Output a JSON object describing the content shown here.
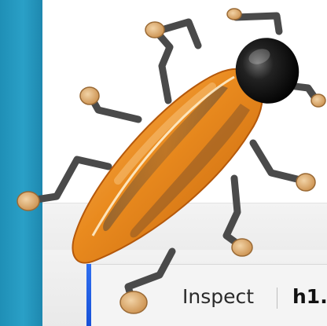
{
  "toolbar": {
    "inspect_label": "Inspect",
    "breadcrumb_label": "h1."
  },
  "logo": {
    "icon": "firebug-bug-icon",
    "body_color": "#e98a1e",
    "head_color": "#161616",
    "leg_color": "#4a4a4a",
    "foot_color": "#d6a060"
  },
  "colors": {
    "side_strip": "#2aa0c7",
    "status_accent": "#2f6ff0"
  }
}
